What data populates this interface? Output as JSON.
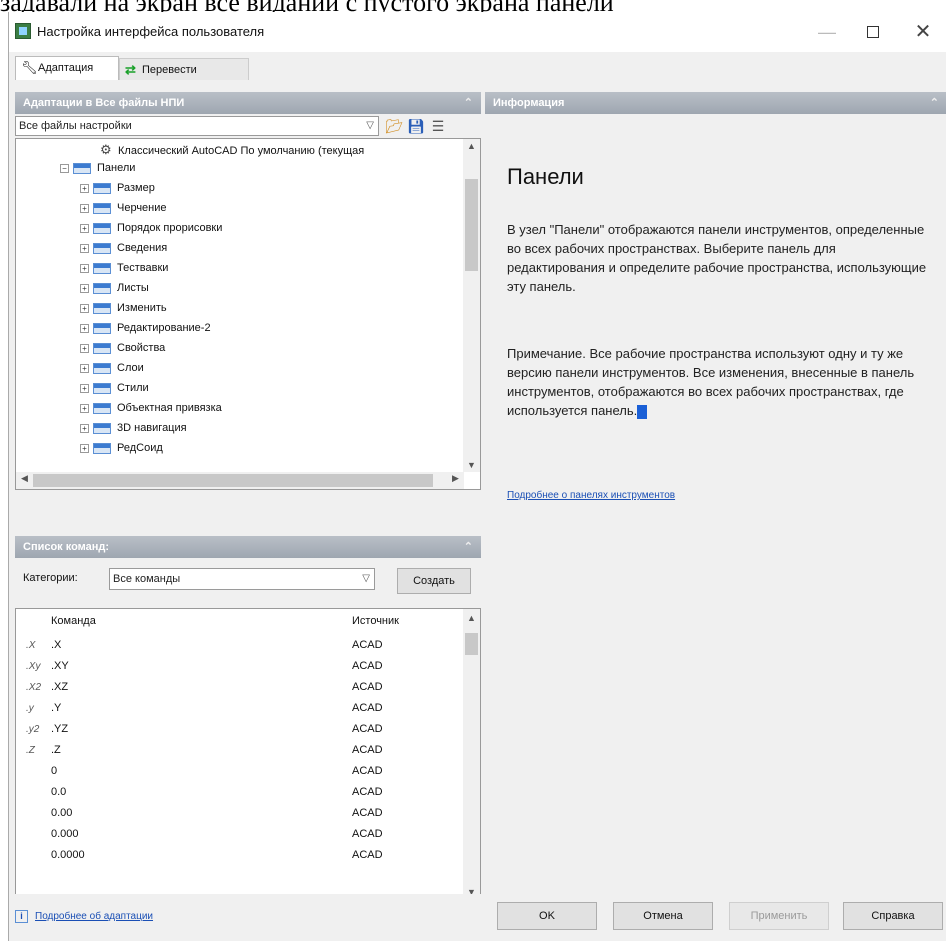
{
  "caption_fragment": "задавали на экран все видании с пустого экрана панели",
  "window": {
    "title": "Настройка интерфейса пользователя"
  },
  "tabs": [
    {
      "label": "Адаптация",
      "icon": "wrench-icon",
      "active": true
    },
    {
      "label": "Перевести",
      "icon": "transfer-arrows-icon",
      "active": false
    }
  ],
  "customize_panel": {
    "header": "Адаптации в Все файлы НПИ",
    "filter_value": "Все файлы настройки",
    "tree": [
      {
        "label": "Классический AutoCAD По умолчанию (текущая",
        "icon": "gear-icon",
        "level": 3,
        "expander": ""
      },
      {
        "label": "Панели",
        "icon": "toolbar-icon",
        "level": 1,
        "expander": "−"
      },
      {
        "label": "Размер",
        "icon": "toolbar-icon",
        "level": 2,
        "expander": "+"
      },
      {
        "label": "Черчение",
        "icon": "toolbar-icon",
        "level": 2,
        "expander": "+"
      },
      {
        "label": "Порядок прорисовки",
        "icon": "toolbar-icon",
        "level": 2,
        "expander": "+"
      },
      {
        "label": "Сведения",
        "icon": "toolbar-icon",
        "level": 2,
        "expander": "+"
      },
      {
        "label": "Тествавки",
        "icon": "toolbar-icon",
        "level": 2,
        "expander": "+"
      },
      {
        "label": "Листы",
        "icon": "toolbar-icon",
        "level": 2,
        "expander": "+"
      },
      {
        "label": "Изменить",
        "icon": "toolbar-icon",
        "level": 2,
        "expander": "+"
      },
      {
        "label": "Редактирование-2",
        "icon": "toolbar-icon",
        "level": 2,
        "expander": "+"
      },
      {
        "label": "Свойства",
        "icon": "toolbar-icon",
        "level": 2,
        "expander": "+"
      },
      {
        "label": "Слои",
        "icon": "toolbar-icon",
        "level": 2,
        "expander": "+"
      },
      {
        "label": "Стили",
        "icon": "toolbar-icon",
        "level": 2,
        "expander": "+"
      },
      {
        "label": "Объектная привязка",
        "icon": "toolbar-icon",
        "level": 2,
        "expander": "+"
      },
      {
        "label": "3D навигация",
        "icon": "toolbar-icon",
        "level": 2,
        "expander": "+"
      },
      {
        "label": "РедСоид",
        "icon": "toolbar-icon",
        "level": 2,
        "expander": "+"
      }
    ]
  },
  "command_panel": {
    "header": "Список команд:",
    "category_label": "Категории:",
    "category_value": "Все команды",
    "create_button": "Создать",
    "columns": [
      "Команда",
      "Источник"
    ],
    "rows": [
      {
        "icon": ".X",
        "name": ".X",
        "source": "ACAD"
      },
      {
        "icon": ".Xy",
        "name": ".XY",
        "source": "ACAD"
      },
      {
        "icon": ".X2",
        "name": ".XZ",
        "source": "ACAD"
      },
      {
        "icon": ".y",
        "name": ".Y",
        "source": "ACAD"
      },
      {
        "icon": ".y2",
        "name": ".YZ",
        "source": "ACAD"
      },
      {
        "icon": ".Z",
        "name": ".Z",
        "source": "ACAD"
      },
      {
        "icon": "",
        "name": "0",
        "source": "ACAD"
      },
      {
        "icon": "",
        "name": "0.0",
        "source": "ACAD"
      },
      {
        "icon": "",
        "name": "0.00",
        "source": "ACAD"
      },
      {
        "icon": "",
        "name": "0.000",
        "source": "ACAD"
      },
      {
        "icon": "",
        "name": "0.0000",
        "source": "ACAD"
      }
    ]
  },
  "info_panel": {
    "header": "Информация",
    "title": "Панели",
    "paragraph1": "В узел \"Панели\" отображаются панели инструментов, определенные во всех рабочих пространствах. Выберите панель для редактирования и определите рабочие пространства, использующие эту панель.",
    "paragraph2": "Примечание. Все рабочие пространства используют одну и ту же версию панели инструментов. Все изменения, внесенные в панель инструментов, отображаются во всех рабочих пространствах, где используется панель.",
    "link": "Подробнее о панелях инструментов"
  },
  "footer": {
    "help_link": "Подробнее об адаптации",
    "ok": "OK",
    "cancel": "Отмена",
    "apply": "Применить",
    "help": "Справка"
  }
}
